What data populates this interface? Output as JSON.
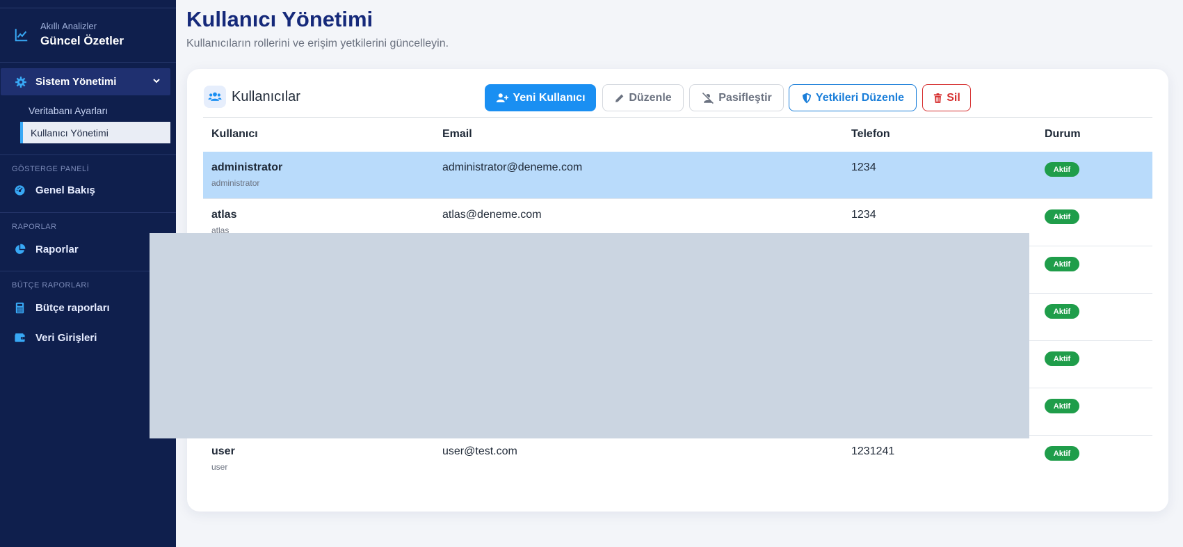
{
  "sidebar": {
    "brand_sub": "Akıllı Analizler",
    "brand_title": "Güncel Özetler",
    "active_menu": "Sistem Yönetimi",
    "submenu": [
      "Veritabanı Ayarları",
      "Kullanıcı Yönetimi"
    ],
    "sections": [
      {
        "title": "GÖSTERGE PANELİ",
        "items": [
          "Genel Bakış"
        ]
      },
      {
        "title": "RAPORLAR",
        "items": [
          "Raporlar"
        ]
      },
      {
        "title": "BÜTÇE RAPORLARI",
        "items": [
          "Bütçe raporları",
          "Veri Girişleri"
        ]
      }
    ],
    "icons": {
      "brand": "chart-line-icon",
      "active_menu": "gear-icon",
      "genel_bakis": "gauge-icon",
      "raporlar": "pie-chart-icon",
      "butce": "calculator-icon",
      "veri": "wallet-icon"
    }
  },
  "header": {
    "title": "Kullanıcı Yönetimi",
    "subtitle": "Kullanıcıların rollerini ve erişim yetkilerini güncelleyin."
  },
  "card": {
    "title": "Kullanıcılar",
    "buttons": {
      "new": "Yeni Kullanıcı",
      "edit": "Düzenle",
      "passive": "Pasifleştir",
      "permissions": "Yetkileri Düzenle",
      "delete": "Sil"
    }
  },
  "table": {
    "columns": [
      "Kullanıcı",
      "Email",
      "Telefon",
      "Durum"
    ],
    "rows": [
      {
        "name": "administrator",
        "username": "administrator",
        "email": "administrator@deneme.com",
        "phone": "1234",
        "status": "Aktif",
        "selected": true
      },
      {
        "name": "atlas",
        "username": "atlas",
        "email": "atlas@deneme.com",
        "phone": "1234",
        "status": "Aktif"
      },
      {
        "name": "",
        "username": "",
        "email": "",
        "phone": "",
        "status": "Aktif"
      },
      {
        "name": "",
        "username": "",
        "email": "",
        "phone": "",
        "status": "Aktif"
      },
      {
        "name": "",
        "username": "",
        "email": "",
        "phone": "",
        "status": "Aktif"
      },
      {
        "name": "",
        "username": "",
        "email": "",
        "phone": "",
        "status": "Aktif"
      },
      {
        "name": "user",
        "username": "user",
        "email": "user@test.com",
        "phone": "1231241",
        "status": "Aktif"
      }
    ]
  },
  "colors": {
    "sidebar_bg": "#0f1f4d",
    "accent": "#1a8ff2",
    "selected_row": "#b9dbfb",
    "status_active": "#1f9d4a",
    "danger": "#d62f2f"
  }
}
